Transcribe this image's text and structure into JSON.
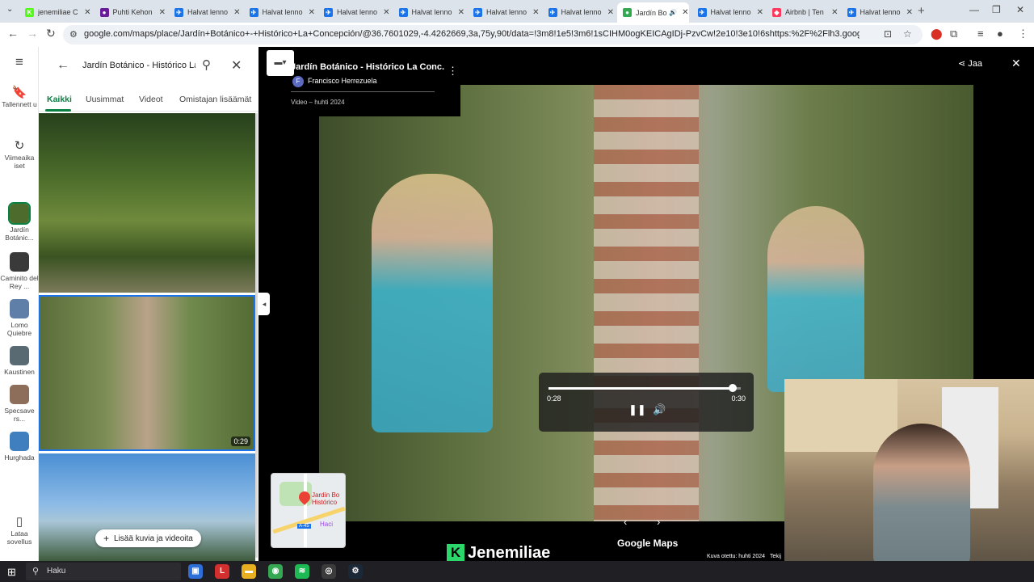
{
  "colors": {
    "maps_accent": "#0b8043",
    "selection_blue": "#1a73e8",
    "brand_green": "#2bd66b"
  },
  "browser": {
    "tabs": [
      {
        "label": "jenemiliae C",
        "icon": "kick-icon",
        "color": "#53fc18",
        "glyph": "K"
      },
      {
        "label": "Puhti Kehon",
        "icon": "puhti-icon",
        "color": "#6a1b9a",
        "glyph": "●"
      },
      {
        "label": "Halvat lenno",
        "icon": "google-flights-icon",
        "color": "#1a73e8",
        "glyph": "✈"
      },
      {
        "label": "Halvat lenno",
        "icon": "google-flights-icon",
        "color": "#1a73e8",
        "glyph": "✈"
      },
      {
        "label": "Halvat lenno",
        "icon": "google-flights-icon",
        "color": "#1a73e8",
        "glyph": "✈"
      },
      {
        "label": "Halvat lenno",
        "icon": "google-flights-icon",
        "color": "#1a73e8",
        "glyph": "✈"
      },
      {
        "label": "Halvat lenno",
        "icon": "google-flights-icon",
        "color": "#1a73e8",
        "glyph": "✈"
      },
      {
        "label": "Halvat lenno",
        "icon": "google-flights-icon",
        "color": "#1a73e8",
        "glyph": "✈"
      },
      {
        "label": "Jardín Bo",
        "icon": "google-maps-icon",
        "color": "#34a853",
        "glyph": "●",
        "active": true,
        "audio_icon": "speaker-icon"
      },
      {
        "label": "Halvat lenno",
        "icon": "google-flights-icon",
        "color": "#1a73e8",
        "glyph": "✈"
      },
      {
        "label": "Airbnb | Ten",
        "icon": "airbnb-icon",
        "color": "#ff385c",
        "glyph": "◆"
      },
      {
        "label": "Halvat lenno",
        "icon": "google-flights-icon",
        "color": "#1a73e8",
        "glyph": "✈"
      }
    ],
    "close_glyph": "✕",
    "audio_glyph": "🔊",
    "url": "google.com/maps/place/Jardín+Botánico+-+Histórico+La+Concepción/@36.7601029,-4.4262669,3a,75y,90t/data=!3m8!1e5!3m6!1sCIHM0ogKEICAgIDj-PzvCw!2e10!3e10!6shttps:%2F%2Flh3.googleusercontent.com%2Fgps-cs-s%2FAG0il..."
  },
  "sidebar": {
    "menu_icon": "hamburger-menu-icon",
    "items": [
      {
        "label": "Tallennett u",
        "icon": "bookmark-icon",
        "glyph": "🔖"
      },
      {
        "label": "Viimeaika iset",
        "icon": "history-icon",
        "glyph": "↻"
      },
      {
        "label": "Jardín Botánic...",
        "icon": "place-thumbnail",
        "color": "#4e6b2e"
      },
      {
        "label": "Caminito del Rey ...",
        "icon": "place-thumbnail",
        "color": "#3a3a3a"
      },
      {
        "label": "Lomo Quiebre",
        "icon": "place-thumbnail",
        "color": "#5f7fa8"
      },
      {
        "label": "Kaustinen",
        "icon": "place-thumbnail",
        "color": "#5a6a73"
      },
      {
        "label": "Specsave rs...",
        "icon": "place-thumbnail",
        "color": "#8c6e5a"
      },
      {
        "label": "Hurghada",
        "icon": "place-thumbnail",
        "color": "#3f7fbf"
      }
    ],
    "download_label": "Lataa sovellus",
    "download_icon": "phone-icon"
  },
  "search": {
    "query": "Jardín Botánico - Histórico La"
  },
  "photos_panel": {
    "tabs": [
      {
        "label": "Kaikki",
        "active": true
      },
      {
        "label": "Uusimmat"
      },
      {
        "label": "Videot"
      },
      {
        "label": "Omistajan lisäämät"
      }
    ],
    "selected_duration": "0:29",
    "add_button": "Lisää kuvia ja videoita"
  },
  "viewer": {
    "title": "Jardín Botánico - Histórico La Conc...",
    "author_initial": "F",
    "author_name": "Francisco Herrezuela",
    "meta": "Video – huhti 2024",
    "share_label": "Jaa",
    "map_label": "Jardín Bo Histórico",
    "map_road_label": "A-45",
    "map_poi_label": "Haci",
    "footer_brand": "Google Maps",
    "capture_date": "Kuva otettu: huhti 2024",
    "credit_cut": "Tekij"
  },
  "video_player": {
    "current_time": "0:28",
    "total_time": "0:30",
    "progress_fraction": 0.96
  },
  "stream_overlay": {
    "brand_glyph": "K",
    "brand_name": "Jenemiliae"
  },
  "taskbar": {
    "search_label": "Haku",
    "apps": [
      {
        "icon": "store-icon",
        "color": "#2d6fd6",
        "glyph": "▣"
      },
      {
        "icon": "app-l-icon",
        "color": "#d32f2f",
        "glyph": "L"
      },
      {
        "icon": "file-explorer-icon",
        "color": "#e8b021",
        "glyph": "▬"
      },
      {
        "icon": "chrome-icon",
        "color": "#34a853",
        "glyph": "◉"
      },
      {
        "icon": "spotify-icon",
        "color": "#1db954",
        "glyph": "≋"
      },
      {
        "icon": "obs-icon",
        "color": "#3b3b3b",
        "glyph": "◎"
      },
      {
        "icon": "steam-icon",
        "color": "#1b2838",
        "glyph": "⚙"
      }
    ]
  }
}
